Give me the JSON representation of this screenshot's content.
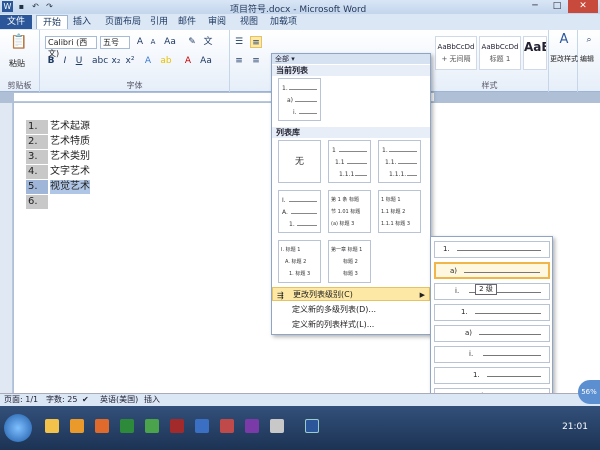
{
  "window": {
    "title": "项目符号.docx - Microsoft Word"
  },
  "tabs": [
    "文件",
    "开始",
    "插入",
    "页面布局",
    "引用",
    "邮件",
    "审阅",
    "视图",
    "加载项"
  ],
  "ribbon": {
    "font_name": "Calibri (西文)",
    "font_size": "五号",
    "paste_label": "粘贴",
    "groups": {
      "clipboard": "剪贴板",
      "font": "字体",
      "styles": "样式"
    },
    "styles": [
      {
        "preview": "AaBbCcDd",
        "name": "+ 无间隔"
      },
      {
        "preview": "AaBbCcDd",
        "name": "标题 1"
      },
      {
        "preview": "AaBb",
        "name": ""
      }
    ],
    "change_styles": "更改样式",
    "edit": "编辑"
  },
  "document": {
    "items": [
      {
        "num": "1.",
        "text": "艺术起源"
      },
      {
        "num": "2.",
        "text": "艺术特质"
      },
      {
        "num": "3.",
        "text": "艺术类别"
      },
      {
        "num": "4.",
        "text": "文字艺术"
      },
      {
        "num": "5.",
        "text": "视觉艺术"
      },
      {
        "num": "6.",
        "text": ""
      }
    ]
  },
  "dropdown": {
    "header": "全部",
    "current_section": "当前列表",
    "library_section": "列表库",
    "none_label": "无",
    "current": [
      "1.",
      "a)",
      "i."
    ],
    "lib": [
      {
        "lines": [
          "1",
          "1.1",
          "1.1.1"
        ]
      },
      {
        "lines": [
          "1.",
          "1.1.",
          "1.1.1."
        ]
      },
      {
        "lines": [
          "I.",
          "A.",
          "1."
        ]
      },
      {
        "lines": [
          "第 1 条 标题",
          "节 1.01 标题",
          "(a) 标题 3"
        ]
      },
      {
        "lines": [
          "1 标题 1",
          "1.1 标题 2",
          "1.1.1 标题 3"
        ]
      },
      {
        "lines": [
          "I. 标题 1",
          "A. 标题 2",
          "1. 标题 3"
        ]
      },
      {
        "lines": [
          "第一章 标题 1",
          "标题 2",
          "标题 3"
        ]
      }
    ],
    "menu": [
      {
        "label": "更改列表级别(C)",
        "has_arrow": true,
        "hover": true
      },
      {
        "label": "定义新的多级列表(D)...",
        "has_arrow": false,
        "hover": false
      },
      {
        "label": "定义新的列表样式(L)...",
        "has_arrow": false,
        "hover": false
      }
    ]
  },
  "submenu": {
    "levels": [
      "1.",
      "a)",
      "i.",
      "1.",
      "a)",
      "i.",
      "1.",
      "a)",
      "i."
    ],
    "tooltip": "2 级"
  },
  "status": {
    "page": "页面: 1/1",
    "words": "字数: 25",
    "language": "英语(美国)",
    "mode": "插入",
    "zoom": "56%"
  },
  "taskbar": {
    "time": "21:01"
  },
  "colors": {
    "accent": "#2b579a",
    "highlight": "#fde9a5",
    "selected_level": "#f0b64a"
  }
}
